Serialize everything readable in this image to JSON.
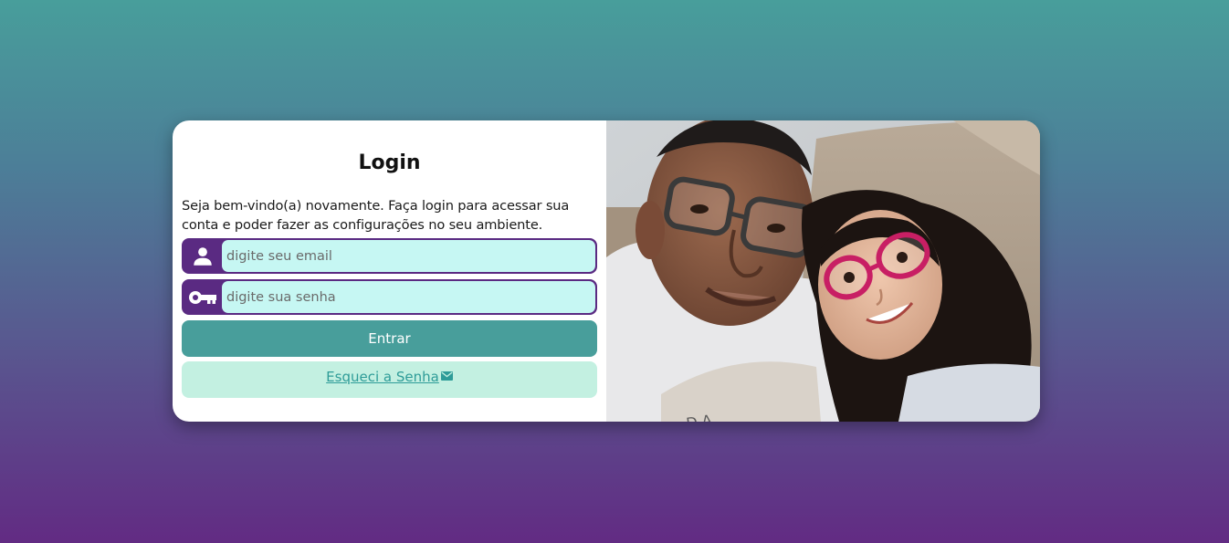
{
  "login": {
    "title": "Login",
    "welcome_text": "Seja bem-vindo(a) novamente. Faça login para acessar sua conta e poder fazer as configurações no seu ambiente.",
    "email_placeholder": "digite seu email",
    "password_placeholder": "digite sua senha",
    "submit_label": "Entrar",
    "forgot_label": "Esqueci a Senha ",
    "icons": {
      "email": "user-icon",
      "password": "key-icon",
      "forgot": "envelope-icon"
    }
  },
  "colors": {
    "accent_purple": "#5a2a82",
    "accent_teal": "#489e9b",
    "input_background": "#c6f7f3",
    "forgot_background": "#c3f0e1",
    "link": "#2e9c98"
  },
  "photo": {
    "icon": "selfie-photo"
  }
}
